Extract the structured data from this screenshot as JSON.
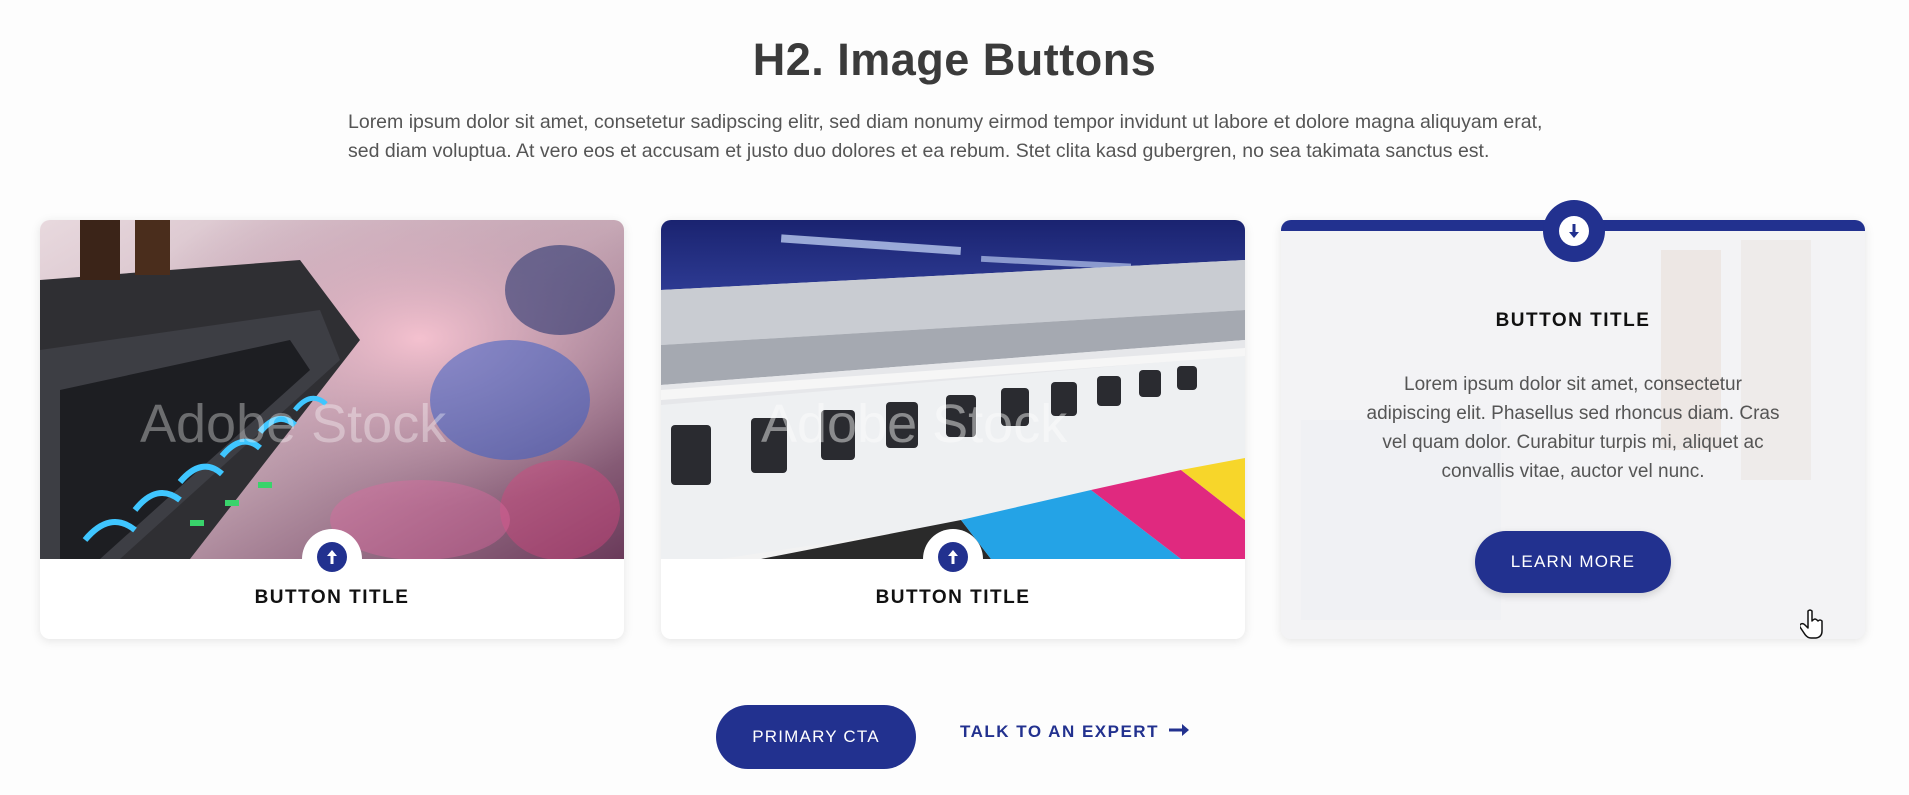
{
  "section": {
    "heading": "H2. Image Buttons",
    "intro": "Lorem ipsum dolor sit amet, consetetur sadipscing elitr, sed diam nonumy eirmod tempor invidunt ut labore et dolore magna aliquyam erat, sed diam voluptua. At vero eos et accusam et justo duo dolores et ea rebum. Stet clita kasd gubergren, no sea takimata sanctus est."
  },
  "cards": [
    {
      "title": "BUTTON TITLE",
      "image": "printer-closeup-photo",
      "watermark": "Adobe Stock",
      "icon": "arrow-up-icon"
    },
    {
      "title": "BUTTON TITLE",
      "image": "wide-format-printer-photo",
      "watermark": "Adobe Stock",
      "icon": "arrow-up-icon"
    },
    {
      "title": "BUTTON TITLE",
      "description": "Lorem ipsum dolor sit amet, consectetur adipiscing elit. Phasellus sed rhoncus diam. Cras vel quam dolor. Curabitur turpis mi, aliquet ac convallis vitae, auctor vel nunc.",
      "button_label": "LEARN MORE",
      "icon": "arrow-down-icon",
      "state": "hover"
    }
  ],
  "cta": {
    "primary_label": "PRIMARY CTA",
    "expert_label": "TALK TO AN EXPERT"
  },
  "colors": {
    "brand": "#22318f",
    "heading": "#3b3b3b",
    "body_text": "#555555"
  }
}
